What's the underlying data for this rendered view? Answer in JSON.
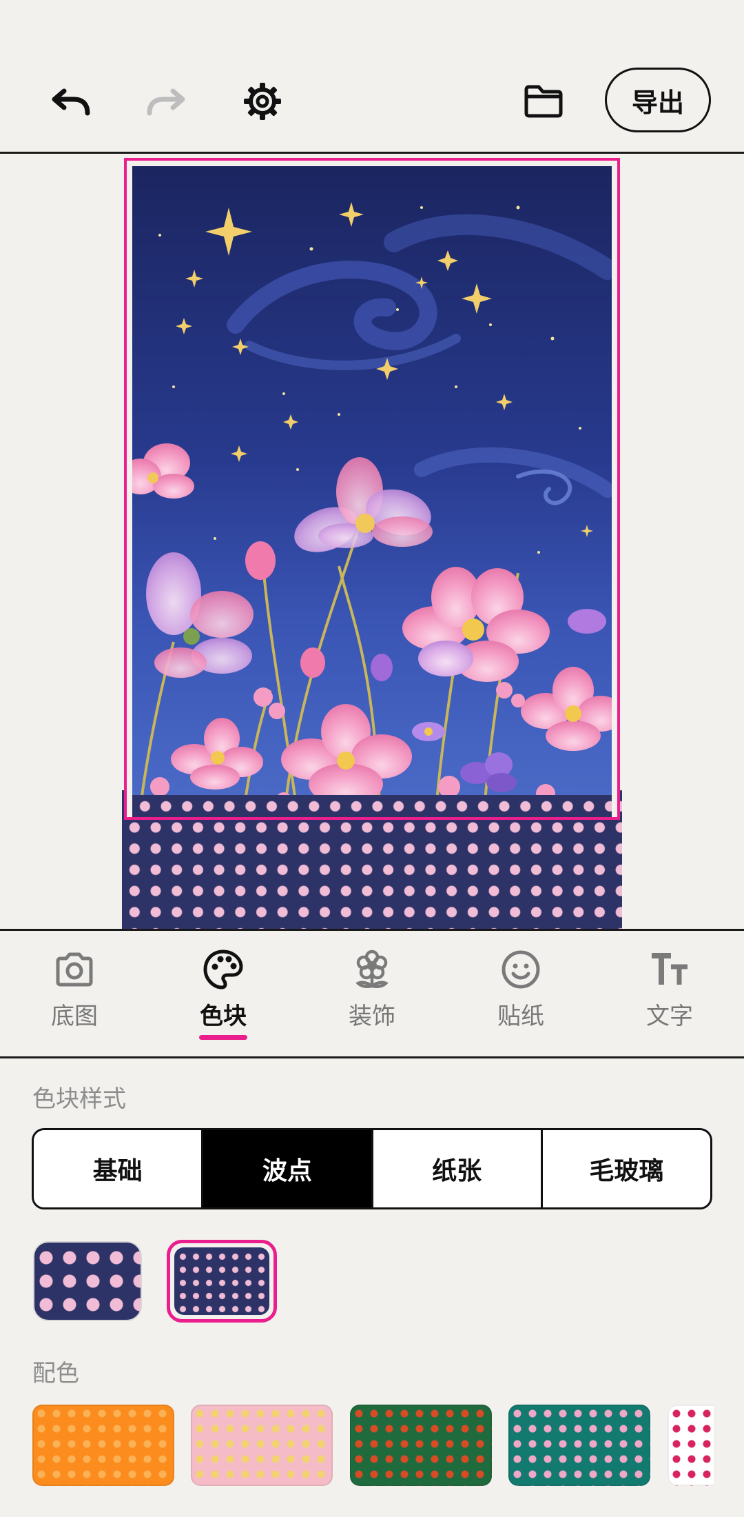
{
  "toolbar": {
    "undo_icon": "undo-icon",
    "redo_icon": "redo-icon",
    "settings_icon": "gear-icon",
    "folder_icon": "folder-icon",
    "export_label": "导出"
  },
  "tabs": [
    {
      "label": "底图",
      "icon": "camera-icon",
      "active": false
    },
    {
      "label": "色块",
      "icon": "palette-icon",
      "active": true
    },
    {
      "label": "装饰",
      "icon": "flower-icon",
      "active": false
    },
    {
      "label": "贴纸",
      "icon": "smiley-icon",
      "active": false
    },
    {
      "label": "文字",
      "icon": "text-size-icon",
      "active": false
    }
  ],
  "block_style": {
    "title": "色块样式",
    "options": [
      "基础",
      "波点",
      "纸张",
      "毛玻璃"
    ],
    "selected": "波点"
  },
  "pattern_thumbs": [
    {
      "name": "large-dots",
      "bg": "#2e3367",
      "dot": "#f1bcd6",
      "selected": false
    },
    {
      "name": "small-dots",
      "bg": "#2e3367",
      "dot": "#f1bcd6",
      "selected": true
    }
  ],
  "color_scheme": {
    "title": "配色",
    "swatches": [
      {
        "bg": "#fb8c1d",
        "dot": "#fbb257"
      },
      {
        "bg": "#f5bcc8",
        "dot": "#f2d36e"
      },
      {
        "bg": "#1f6b3e",
        "dot": "#d84b24"
      },
      {
        "bg": "#137a70",
        "dot": "#f0a8c8"
      },
      {
        "bg": "#ffffff",
        "dot": "#d8245e"
      }
    ]
  },
  "colors": {
    "accent": "#ea1e8c",
    "dot_block_bg": "#2e3367",
    "dot_block_dot": "#f1bcd6"
  }
}
